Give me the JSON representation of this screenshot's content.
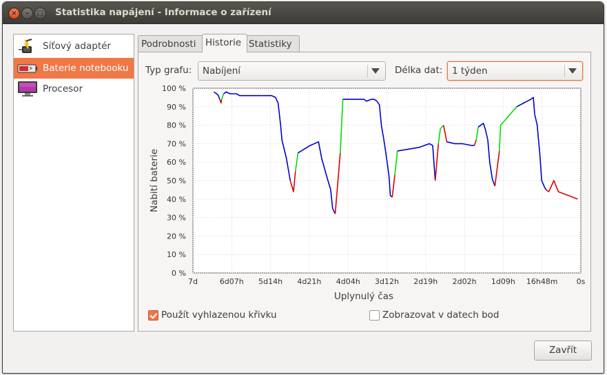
{
  "window": {
    "title": "Statistika napájení - Informace o zařízení"
  },
  "sidebar": {
    "items": [
      {
        "label": "Síťový adaptér",
        "icon": "power-adapter-icon",
        "selected": false
      },
      {
        "label": "Baterie notebooku",
        "icon": "laptop-battery-icon",
        "selected": true
      },
      {
        "label": "Procesor",
        "icon": "monitor-icon",
        "selected": false
      }
    ]
  },
  "tabs": [
    {
      "label": "Podrobnosti",
      "active": false
    },
    {
      "label": "Historie",
      "active": true
    },
    {
      "label": "Statistiky",
      "active": false
    }
  ],
  "controls": {
    "graph_type_label": "Typ grafu:",
    "graph_type_value": "Nabíjení",
    "data_length_label": "Délka dat:",
    "data_length_value": "1 týden"
  },
  "chart_data": {
    "type": "line",
    "xlabel": "Uplynulý čas",
    "ylabel": "Nabití baterie",
    "ylim": [
      0,
      100
    ],
    "xlim": [
      -604800,
      0
    ],
    "x_tick_labels": [
      "7d",
      "6d07h",
      "5d14h",
      "4d21h",
      "4d04h",
      "3d12h",
      "2d19h",
      "2d02h",
      "1d09h",
      "16h48m",
      "0s"
    ],
    "y_tick_labels": [
      "0 %",
      "10 %",
      "20 %",
      "30 %",
      "40 %",
      "50 %",
      "60 %",
      "70 %",
      "80 %",
      "90 %",
      "100 %"
    ],
    "grid": true,
    "colors": {
      "discharging": "#0000cc",
      "charging": "#00dd00",
      "other": "#dd0000"
    },
    "series": [
      {
        "state": "discharging",
        "points": [
          [
            -572000,
            98
          ],
          [
            -568000,
            97
          ],
          [
            -565000,
            96
          ],
          [
            -563000,
            94
          ]
        ]
      },
      {
        "state": "other",
        "points": [
          [
            -563000,
            94
          ],
          [
            -561000,
            92
          ],
          [
            -560000,
            94
          ]
        ]
      },
      {
        "state": "charging",
        "points": [
          [
            -560000,
            94
          ],
          [
            -557000,
            97
          ]
        ]
      },
      {
        "state": "discharging",
        "points": [
          [
            -557000,
            97
          ],
          [
            -553000,
            98
          ],
          [
            -547000,
            97
          ],
          [
            -542000,
            97
          ],
          [
            -537000,
            97
          ],
          [
            -532000,
            96
          ],
          [
            -530000,
            96
          ],
          [
            -524000,
            96
          ],
          [
            -515000,
            96
          ],
          [
            -505000,
            96
          ],
          [
            -497000,
            96
          ],
          [
            -488000,
            96
          ],
          [
            -482000,
            96
          ],
          [
            -476000,
            95
          ],
          [
            -472000,
            92
          ],
          [
            -468000,
            80
          ],
          [
            -466000,
            72
          ],
          [
            -459000,
            62
          ],
          [
            -453000,
            50
          ]
        ]
      },
      {
        "state": "other",
        "points": [
          [
            -453000,
            50
          ],
          [
            -448000,
            44
          ],
          [
            -445000,
            55
          ]
        ]
      },
      {
        "state": "charging",
        "points": [
          [
            -445000,
            55
          ],
          [
            -441000,
            65
          ]
        ]
      },
      {
        "state": "discharging",
        "points": [
          [
            -441000,
            65
          ],
          [
            -422000,
            69
          ],
          [
            -409000,
            71
          ],
          [
            -404000,
            62
          ],
          [
            -396000,
            52
          ],
          [
            -390000,
            45
          ],
          [
            -387000,
            35
          ],
          [
            -383000,
            32
          ]
        ]
      },
      {
        "state": "other",
        "points": [
          [
            -383000,
            32
          ],
          [
            -375000,
            65
          ]
        ]
      },
      {
        "state": "charging",
        "points": [
          [
            -375000,
            65
          ],
          [
            -371000,
            94
          ]
        ]
      },
      {
        "state": "discharging",
        "points": [
          [
            -371000,
            94
          ],
          [
            -365000,
            94
          ],
          [
            -345000,
            94
          ],
          [
            -338000,
            94
          ],
          [
            -334000,
            93
          ],
          [
            -327000,
            94
          ],
          [
            -322000,
            94
          ],
          [
            -318000,
            93
          ],
          [
            -314000,
            91
          ],
          [
            -311000,
            80
          ],
          [
            -307000,
            72
          ],
          [
            -302000,
            60
          ],
          [
            -299000,
            52
          ],
          [
            -297000,
            42
          ],
          [
            -294000,
            41
          ]
        ]
      },
      {
        "state": "other",
        "points": [
          [
            -294000,
            41
          ],
          [
            -290000,
            53
          ]
        ]
      },
      {
        "state": "charging",
        "points": [
          [
            -290000,
            53
          ],
          [
            -286000,
            66
          ]
        ]
      },
      {
        "state": "discharging",
        "points": [
          [
            -286000,
            66
          ],
          [
            -252000,
            68
          ],
          [
            -236000,
            70
          ],
          [
            -231000,
            69
          ],
          [
            -227000,
            50
          ]
        ]
      },
      {
        "state": "other",
        "points": [
          [
            -227000,
            50
          ],
          [
            -222000,
            70
          ]
        ]
      },
      {
        "state": "charging",
        "points": [
          [
            -222000,
            70
          ],
          [
            -219000,
            78
          ],
          [
            -214000,
            80
          ]
        ]
      },
      {
        "state": "other",
        "points": [
          [
            -214000,
            80
          ],
          [
            -209000,
            71
          ]
        ]
      },
      {
        "state": "discharging",
        "points": [
          [
            -209000,
            71
          ],
          [
            -197000,
            70
          ],
          [
            -185000,
            70
          ],
          [
            -170000,
            69
          ],
          [
            -166000,
            69
          ]
        ]
      },
      {
        "state": "other",
        "points": [
          [
            -166000,
            69
          ],
          [
            -163000,
            72
          ]
        ]
      },
      {
        "state": "charging",
        "points": [
          [
            -163000,
            72
          ],
          [
            -160000,
            79
          ]
        ]
      },
      {
        "state": "discharging",
        "points": [
          [
            -160000,
            79
          ],
          [
            -152000,
            81
          ],
          [
            -149000,
            78
          ],
          [
            -145000,
            72
          ],
          [
            -142000,
            60
          ],
          [
            -138000,
            51
          ],
          [
            -134000,
            47
          ]
        ]
      },
      {
        "state": "other",
        "points": [
          [
            -134000,
            47
          ],
          [
            -127000,
            66
          ]
        ]
      },
      {
        "state": "charging",
        "points": [
          [
            -127000,
            66
          ],
          [
            -125000,
            80
          ],
          [
            -100000,
            90
          ]
        ]
      },
      {
        "state": "discharging",
        "points": [
          [
            -100000,
            90
          ],
          [
            -78000,
            94
          ],
          [
            -74000,
            95
          ],
          [
            -72000,
            86
          ],
          [
            -68000,
            80
          ],
          [
            -66000,
            72
          ],
          [
            -64000,
            65
          ],
          [
            -61000,
            50
          ],
          [
            -56000,
            46
          ],
          [
            -54000,
            45
          ]
        ]
      },
      {
        "state": "other",
        "points": [
          [
            -54000,
            45
          ],
          [
            -50000,
            44
          ],
          [
            -42000,
            50
          ],
          [
            -35000,
            44
          ],
          [
            -20000,
            42
          ],
          [
            -5000,
            40
          ]
        ]
      }
    ]
  },
  "options": {
    "smooth_label": "Použít vyhlazenou křivku",
    "smooth_checked": true,
    "points_label": "Zobrazovat v datech bod",
    "points_checked": false
  },
  "buttons": {
    "close_label": "Zavřít"
  }
}
